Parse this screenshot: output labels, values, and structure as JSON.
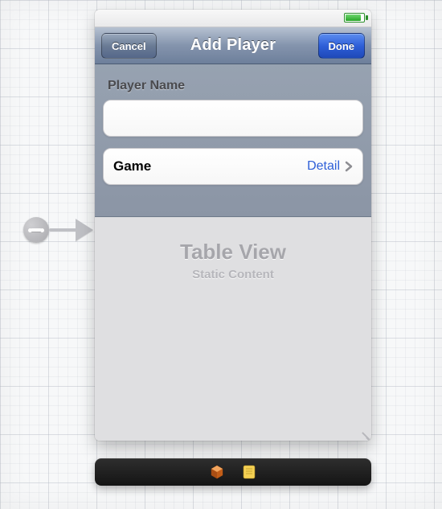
{
  "navbar": {
    "title": "Add Player",
    "cancel_label": "Cancel",
    "done_label": "Done"
  },
  "section1": {
    "header": "Player Name",
    "input_value": "",
    "input_placeholder": ""
  },
  "section2": {
    "row": {
      "label": "Game",
      "detail": "Detail"
    }
  },
  "table_placeholder": {
    "title": "Table View",
    "subtitle": "Static Content"
  },
  "icons": {
    "battery": "battery-icon",
    "chevron": "chevron-right-icon",
    "segue": "segue-push-icon",
    "dock_cube": "object-3d-icon",
    "dock_note": "note-icon"
  },
  "colors": {
    "nav_tint": "#2e5fd8",
    "section_bg": "#8f99a9"
  }
}
